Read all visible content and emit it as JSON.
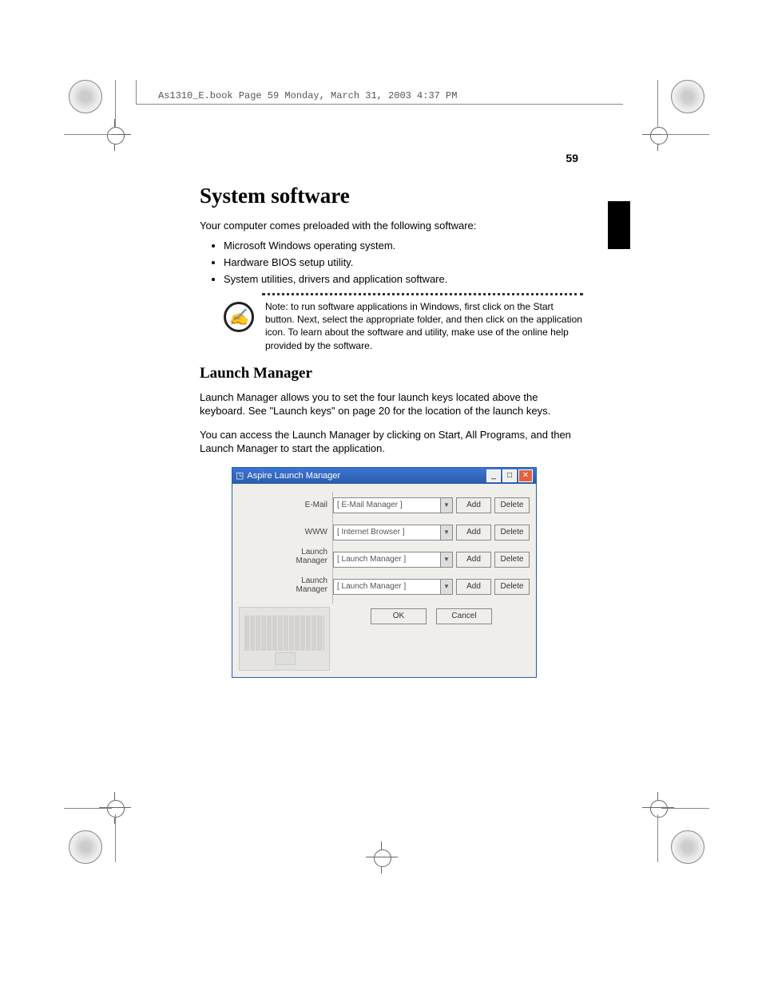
{
  "meta_header": "As1310_E.book  Page 59  Monday, March 31, 2003  4:37 PM",
  "page_number": "59",
  "heading": "System software",
  "intro": "Your computer comes preloaded with the following software:",
  "bullets": {
    "b0": "Microsoft Windows operating system.",
    "b1": "Hardware BIOS setup utility.",
    "b2": "System utilities, drivers and application software."
  },
  "note": "Note: to run software applications in Windows, first click on the Start button. Next, select the appropriate folder, and then click on the application icon. To learn about the software and utility, make use of the online help provided by the software.",
  "sub_heading": "Launch Manager",
  "para1": "Launch Manager allows you to set the four launch keys located above the keyboard.  See \"Launch keys\" on page 20 for the location of the launch keys.",
  "para2": "You can access the Launch Manager by clicking on Start, All Programs, and then Launch Manager to start the application.",
  "dialog": {
    "title": "Aspire Launch Manager",
    "labels": {
      "l0": "E-Mail",
      "l1": "WWW",
      "l2a": "Launch",
      "l2b": "Manager",
      "l3a": "Launch",
      "l3b": "Manager"
    },
    "rows": {
      "r0": "[  E-Mail Manager  ]",
      "r1": "[  Internet Browser  ]",
      "r2": "[  Launch Manager  ]",
      "r3": "[  Launch Manager  ]"
    },
    "btn_add": "Add",
    "btn_delete": "Delete",
    "btn_ok": "OK",
    "btn_cancel": "Cancel"
  }
}
